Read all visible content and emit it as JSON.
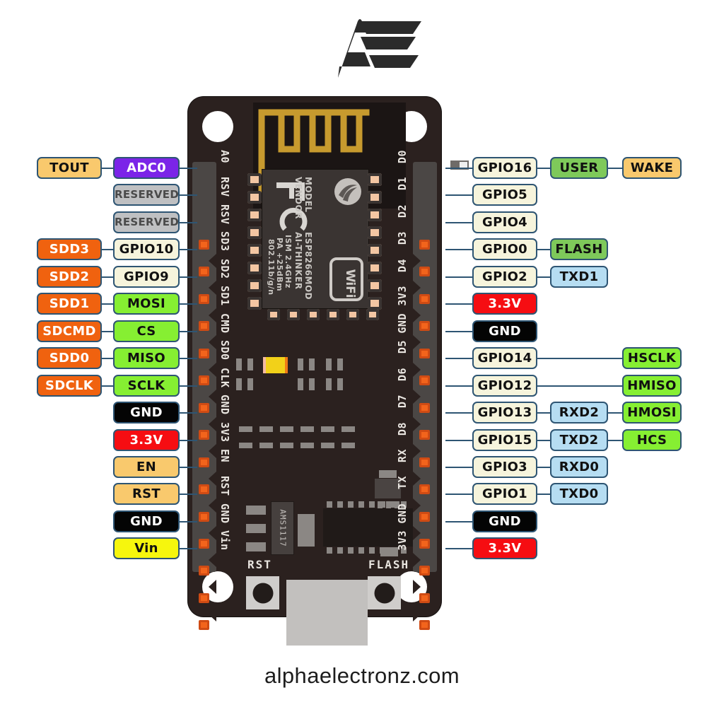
{
  "page": {
    "logo_alt": "AE",
    "footer": "alphaelectronz.com"
  },
  "board": {
    "module": {
      "model_label": "MODEL",
      "model_value": "ESP8266MOD",
      "vendor_label": "VENDOR",
      "vendor_value": "AI-THINKER",
      "spec_ism": "ISM 2.4GHz",
      "spec_pa": "PA +25dBm",
      "spec_std": "802.11b/g/n",
      "fcc_logo": "FC",
      "wifi_logo": "WiFi"
    },
    "regulator": "AMS1117",
    "buttons": [
      {
        "name": "RST",
        "label": "RST"
      },
      {
        "name": "FLASH",
        "label": "FLASH"
      }
    ],
    "silkscreen_left": [
      "A0",
      "RSV",
      "RSV",
      "SD3",
      "SD2",
      "SD1",
      "CMD",
      "SD0",
      "CLK",
      "GND",
      "3V3",
      "EN",
      "RST",
      "GND",
      "Vin"
    ],
    "silkscreen_right": [
      "D0",
      "D1",
      "D2",
      "D3",
      "D4",
      "3V3",
      "GND",
      "D5",
      "D6",
      "D7",
      "D8",
      "RX",
      "TX",
      "GND",
      "3V3"
    ]
  },
  "colors": {
    "orange": "#f0620f",
    "green": "#86ef32",
    "green_alt": "#7ec95a",
    "blue": "#b6ddf2",
    "red": "#f60d12",
    "black": "#040404",
    "yellow": "#f6f60d",
    "tan": "#f9c96d",
    "purple": "#7b24e8",
    "gray": "#bfc0c2",
    "cream": "#f6f4dc",
    "outline": "#2e5573",
    "pcb": "#2b211f"
  },
  "left_pins": [
    {
      "silk": "A0",
      "col1": "TOUT",
      "col1_style": "t-tan",
      "col2": "ADC0",
      "col2_style": "t-purple"
    },
    {
      "silk": "RSV",
      "col1": "",
      "col1_style": "",
      "col2": "RESERVED",
      "col2_style": "t-gray"
    },
    {
      "silk": "RSV",
      "col1": "",
      "col1_style": "",
      "col2": "RESERVED",
      "col2_style": "t-gray"
    },
    {
      "silk": "SD3",
      "col1": "SDD3",
      "col1_style": "t-orange",
      "col2": "GPIO10",
      "col2_style": "t-gpio"
    },
    {
      "silk": "SD2",
      "col1": "SDD2",
      "col1_style": "t-orange",
      "col2": "GPIO9",
      "col2_style": "t-gpio"
    },
    {
      "silk": "SD1",
      "col1": "SDD1",
      "col1_style": "t-orange",
      "col2": "MOSI",
      "col2_style": "t-green"
    },
    {
      "silk": "CMD",
      "col1": "SDCMD",
      "col1_style": "t-orange",
      "col2": "CS",
      "col2_style": "t-green"
    },
    {
      "silk": "SD0",
      "col1": "SDD0",
      "col1_style": "t-orange",
      "col2": "MISO",
      "col2_style": "t-green"
    },
    {
      "silk": "CLK",
      "col1": "SDCLK",
      "col1_style": "t-orange",
      "col2": "SCLK",
      "col2_style": "t-green"
    },
    {
      "silk": "GND",
      "col1": "",
      "col1_style": "",
      "col2": "GND",
      "col2_style": "t-black"
    },
    {
      "silk": "3V3",
      "col1": "",
      "col1_style": "",
      "col2": "3.3V",
      "col2_style": "t-red"
    },
    {
      "silk": "EN",
      "col1": "",
      "col1_style": "",
      "col2": "EN",
      "col2_style": "t-tan"
    },
    {
      "silk": "RST",
      "col1": "",
      "col1_style": "",
      "col2": "RST",
      "col2_style": "t-tan"
    },
    {
      "silk": "GND",
      "col1": "",
      "col1_style": "",
      "col2": "GND",
      "col2_style": "t-black"
    },
    {
      "silk": "Vin",
      "col1": "",
      "col1_style": "",
      "col2": "Vin",
      "col2_style": "t-yellow"
    }
  ],
  "right_pins": [
    {
      "silk": "D0",
      "col1": "GPIO16",
      "col1_style": "t-gpio",
      "col2": "USER",
      "col2_style": "t-green2",
      "col3": "WAKE",
      "col3_style": "t-tan"
    },
    {
      "silk": "D1",
      "col1": "GPIO5",
      "col1_style": "t-gpio",
      "col2": "",
      "col2_style": "",
      "col3": "",
      "col3_style": ""
    },
    {
      "silk": "D2",
      "col1": "GPIO4",
      "col1_style": "t-gpio",
      "col2": "",
      "col2_style": "",
      "col3": "",
      "col3_style": ""
    },
    {
      "silk": "D3",
      "col1": "GPIO0",
      "col1_style": "t-gpio",
      "col2": "FLASH",
      "col2_style": "t-green2",
      "col3": "",
      "col3_style": ""
    },
    {
      "silk": "D4",
      "col1": "GPIO2",
      "col1_style": "t-gpio",
      "col2": "TXD1",
      "col2_style": "t-blue",
      "col3": "",
      "col3_style": ""
    },
    {
      "silk": "3V3",
      "col1": "3.3V",
      "col1_style": "t-red",
      "col2": "",
      "col2_style": "",
      "col3": "",
      "col3_style": ""
    },
    {
      "silk": "GND",
      "col1": "GND",
      "col1_style": "t-black",
      "col2": "",
      "col2_style": "",
      "col3": "",
      "col3_style": ""
    },
    {
      "silk": "D5",
      "col1": "GPIO14",
      "col1_style": "t-gpio",
      "col2": "",
      "col2_style": "",
      "col3": "HSCLK",
      "col3_style": "t-green"
    },
    {
      "silk": "D6",
      "col1": "GPIO12",
      "col1_style": "t-gpio",
      "col2": "",
      "col2_style": "",
      "col3": "HMISO",
      "col3_style": "t-green"
    },
    {
      "silk": "D7",
      "col1": "GPIO13",
      "col1_style": "t-gpio",
      "col2": "RXD2",
      "col2_style": "t-blue",
      "col3": "HMOSI",
      "col3_style": "t-green"
    },
    {
      "silk": "D8",
      "col1": "GPIO15",
      "col1_style": "t-gpio",
      "col2": "TXD2",
      "col2_style": "t-blue",
      "col3": "HCS",
      "col3_style": "t-green"
    },
    {
      "silk": "RX",
      "col1": "GPIO3",
      "col1_style": "t-gpio",
      "col2": "RXD0",
      "col2_style": "t-blue",
      "col3": "",
      "col3_style": ""
    },
    {
      "silk": "TX",
      "col1": "GPIO1",
      "col1_style": "t-gpio",
      "col2": "TXD0",
      "col2_style": "t-blue",
      "col3": "",
      "col3_style": ""
    },
    {
      "silk": "GND",
      "col1": "GND",
      "col1_style": "t-black",
      "col2": "",
      "col2_style": "",
      "col3": "",
      "col3_style": ""
    },
    {
      "silk": "3V3",
      "col1": "3.3V",
      "col1_style": "t-red",
      "col2": "",
      "col2_style": "",
      "col3": "",
      "col3_style": ""
    }
  ]
}
